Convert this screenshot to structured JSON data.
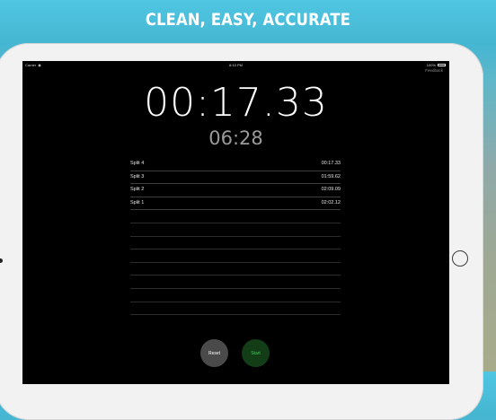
{
  "headline": "CLEAN, EASY, ACCURATE",
  "status_bar": {
    "carrier": "Carrier",
    "time": "8:43 PM",
    "battery": "100%"
  },
  "feedback_label": "Feedback",
  "stopwatch": {
    "main_time": "00:17.33",
    "lap_time": "06:28"
  },
  "splits": [
    {
      "name": "Split 4",
      "time": "00:17.33"
    },
    {
      "name": "Split 3",
      "time": "01:59.62"
    },
    {
      "name": "Split 2",
      "time": "02:09.09"
    },
    {
      "name": "Split 1",
      "time": "02:02.12"
    }
  ],
  "buttons": {
    "reset_label": "Reset",
    "start_label": "Start"
  },
  "colors": {
    "start_text": "#35d24a",
    "start_bg": "#123d17",
    "reset_bg": "#4a4a4a"
  }
}
